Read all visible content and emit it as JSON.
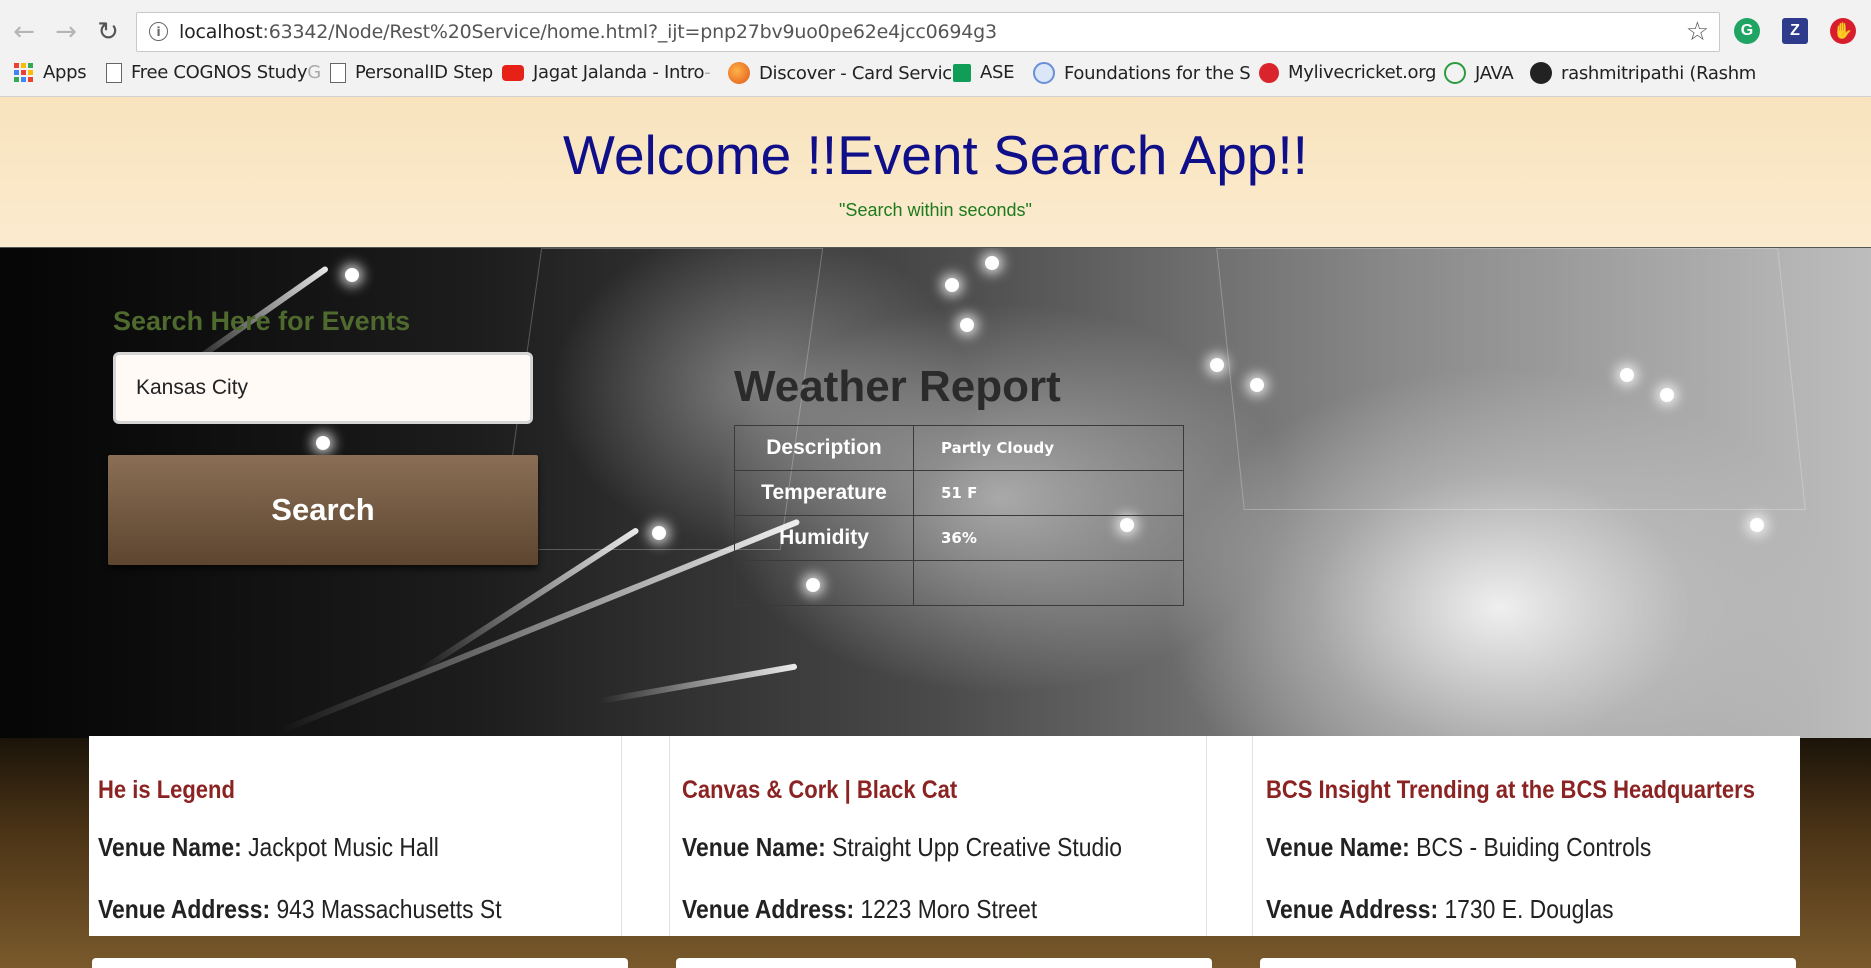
{
  "browser": {
    "url_host": "localhost",
    "url_rest": ":63342/Node/Rest%20Service/home.html?_ijt=pnp27bv9uo0pe62e4jcc0694g3",
    "bookmarks": [
      {
        "label": "Apps",
        "faded": ""
      },
      {
        "label": "Free COGNOS Study ",
        "faded": "G"
      },
      {
        "label": "PersonalID Step",
        "faded": ""
      },
      {
        "label": "Jagat Jalanda - Intro",
        "faded": " -"
      },
      {
        "label": "Discover - Card Servic",
        "faded": ""
      },
      {
        "label": "ASE",
        "faded": ""
      },
      {
        "label": "Foundations for the S",
        "faded": ""
      },
      {
        "label": "Mylivecricket.org",
        "faded": ""
      },
      {
        "label": "JAVA",
        "faded": ""
      },
      {
        "label": "rashmitripathi (Rashm",
        "faded": ""
      }
    ],
    "extensions": [
      "G",
      "Z",
      ""
    ]
  },
  "header": {
    "title": "Welcome !!Event Search App!!",
    "subtitle": "\"Search within seconds\""
  },
  "search": {
    "heading": "Search Here for Events",
    "value": "Kansas City",
    "button_label": "Search"
  },
  "weather": {
    "title": "Weather Report",
    "rows": [
      {
        "label": "Description",
        "value": "Partly Cloudy"
      },
      {
        "label": "Temperature",
        "value": "51 F"
      },
      {
        "label": "Humidity",
        "value": "36%"
      },
      {
        "label": "",
        "value": ""
      }
    ]
  },
  "events": [
    {
      "title": "He is Legend",
      "venue_name_label": "Venue Name:",
      "venue_name": "Jackpot Music Hall",
      "venue_address_label": "Venue Address:",
      "venue_address": "943 Massachusetts St"
    },
    {
      "title": "Canvas & Cork | Black Cat",
      "venue_name_label": "Venue Name:",
      "venue_name": "Straight Upp Creative Studio",
      "venue_address_label": "Venue Address:",
      "venue_address": "1223 Moro Street"
    },
    {
      "title": "BCS Insight Trending at the BCS Headquarters",
      "venue_name_label": "Venue Name:",
      "venue_name": "BCS - Buiding Controls",
      "venue_address_label": "Venue Address:",
      "venue_address": "1730 E. Douglas"
    }
  ],
  "colors": {
    "header_bg": "#f8e3bd",
    "title": "#0f0f8a",
    "subtitle": "#1d7a1d",
    "search_heading": "#4f6a2e",
    "button": "#7a5f45",
    "event_title": "#8b2323"
  }
}
